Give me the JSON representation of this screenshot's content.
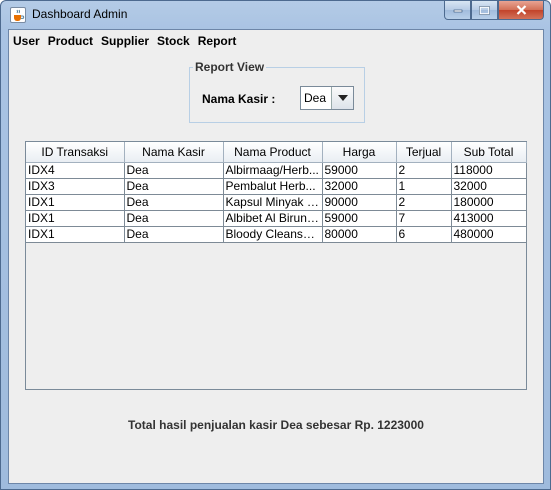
{
  "window": {
    "title": "Dashboard Admin"
  },
  "icons": {
    "app": "java-cup-icon",
    "minimize": "minimize-icon",
    "maximize": "maximize-icon",
    "close": "close-icon",
    "dropdown": "dropdown-arrow-icon"
  },
  "menu": {
    "items": [
      "User",
      "Product",
      "Supplier",
      "Stock",
      "Report"
    ]
  },
  "report_view": {
    "legend": "Report View",
    "kasir_label": "Nama Kasir :",
    "kasir_selected": "Dea"
  },
  "table": {
    "headers": [
      "ID Transaksi",
      "Nama Kasir",
      "Nama Product",
      "Harga",
      "Terjual",
      "Sub Total"
    ],
    "rows": [
      [
        "IDX4",
        "Dea",
        "Albirmaag/Herb...",
        "59000",
        "2",
        "118000"
      ],
      [
        "IDX3",
        "Dea",
        "Pembalut Herb...",
        "32000",
        "1",
        "32000"
      ],
      [
        "IDX1",
        "Dea",
        "Kapsul Minyak I...",
        "90000",
        "2",
        "180000"
      ],
      [
        "IDX1",
        "Dea",
        "Albibet Al Biruni...",
        "59000",
        "7",
        "413000"
      ],
      [
        "IDX1",
        "Dea",
        "Bloody Cleanse...",
        "80000",
        "6",
        "480000"
      ]
    ]
  },
  "summary": {
    "total_text": "Total hasil penjualan kasir Dea sebesar Rp. 1223000"
  }
}
